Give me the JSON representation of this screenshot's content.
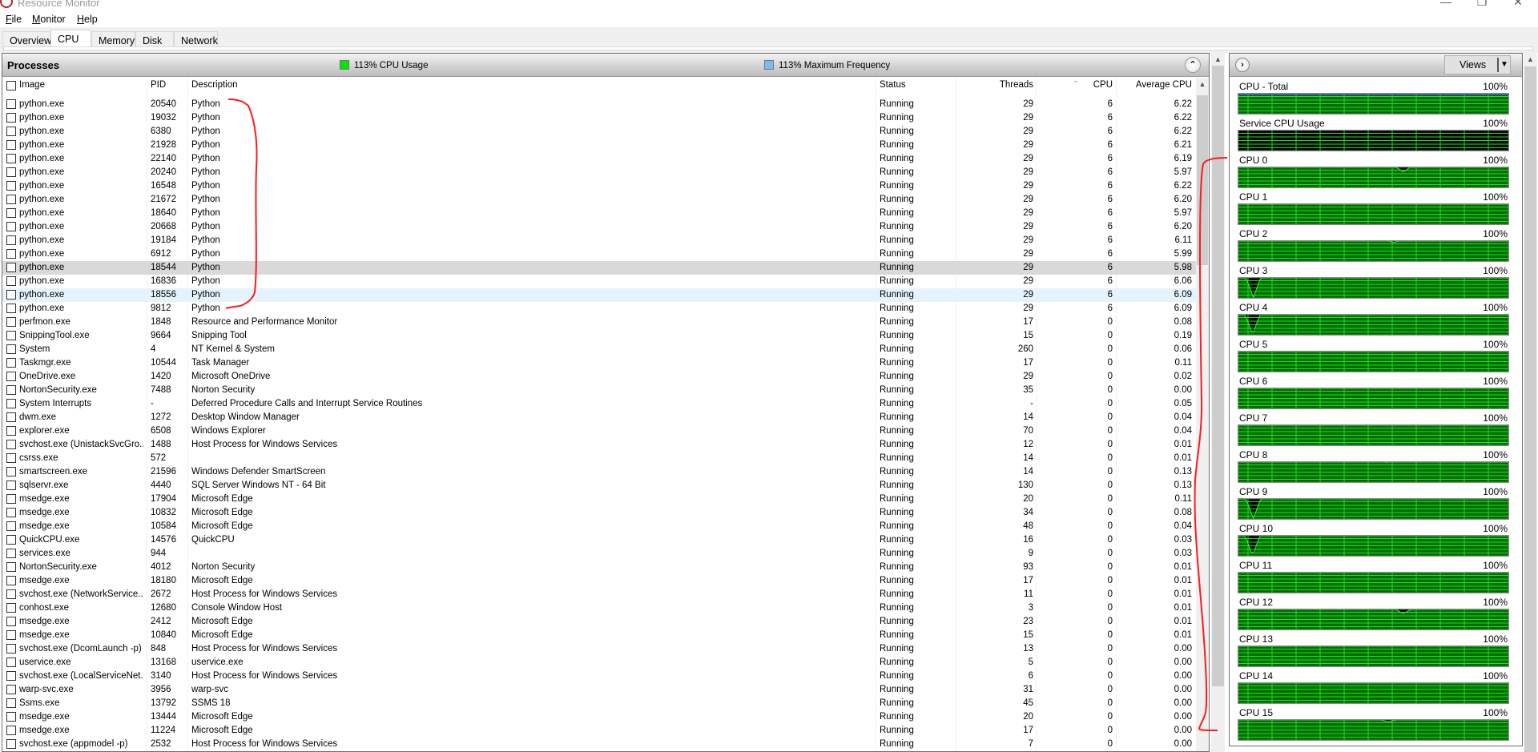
{
  "window": {
    "title": "Resource Monitor",
    "controls": {
      "minimize": "—",
      "maximize": "❐",
      "close": "✕"
    }
  },
  "menu": {
    "items": [
      {
        "label": "File",
        "accel": "F",
        "rest": "ile"
      },
      {
        "label": "Monitor",
        "accel": "M",
        "rest": "onitor"
      },
      {
        "label": "Help",
        "accel": "H",
        "rest": "elp"
      }
    ]
  },
  "tabs": [
    {
      "label": "Overview",
      "active": false
    },
    {
      "label": "CPU",
      "active": true
    },
    {
      "label": "Memory",
      "active": false
    },
    {
      "label": "Disk",
      "active": false
    },
    {
      "label": "Network",
      "active": false
    }
  ],
  "processes": {
    "title": "Processes",
    "cpu_usage": "113% CPU Usage",
    "cpu_usage_color": "#00e600",
    "max_frequency": "113% Maximum Frequency",
    "max_frequency_color": "#7fb8f5",
    "collapse_icon": "chevron-up-icon",
    "columns": {
      "image": "Image",
      "pid": "PID",
      "description": "Description",
      "status": "Status",
      "threads": "Threads",
      "cpu": "CPU",
      "average_cpu": "Average CPU"
    },
    "sorted_column": "cpu",
    "rows": [
      {
        "image": "python.exe",
        "pid": "20540",
        "description": "Python",
        "status": "Running",
        "threads": "29",
        "cpu": "6",
        "avg": "6.22"
      },
      {
        "image": "python.exe",
        "pid": "19032",
        "description": "Python",
        "status": "Running",
        "threads": "29",
        "cpu": "6",
        "avg": "6.22"
      },
      {
        "image": "python.exe",
        "pid": "6380",
        "description": "Python",
        "status": "Running",
        "threads": "29",
        "cpu": "6",
        "avg": "6.22"
      },
      {
        "image": "python.exe",
        "pid": "21928",
        "description": "Python",
        "status": "Running",
        "threads": "29",
        "cpu": "6",
        "avg": "6.21"
      },
      {
        "image": "python.exe",
        "pid": "22140",
        "description": "Python",
        "status": "Running",
        "threads": "29",
        "cpu": "6",
        "avg": "6.19"
      },
      {
        "image": "python.exe",
        "pid": "20240",
        "description": "Python",
        "status": "Running",
        "threads": "29",
        "cpu": "6",
        "avg": "5.97"
      },
      {
        "image": "python.exe",
        "pid": "16548",
        "description": "Python",
        "status": "Running",
        "threads": "29",
        "cpu": "6",
        "avg": "6.22"
      },
      {
        "image": "python.exe",
        "pid": "21672",
        "description": "Python",
        "status": "Running",
        "threads": "29",
        "cpu": "6",
        "avg": "6.20"
      },
      {
        "image": "python.exe",
        "pid": "18640",
        "description": "Python",
        "status": "Running",
        "threads": "29",
        "cpu": "6",
        "avg": "5.97"
      },
      {
        "image": "python.exe",
        "pid": "20668",
        "description": "Python",
        "status": "Running",
        "threads": "29",
        "cpu": "6",
        "avg": "6.20"
      },
      {
        "image": "python.exe",
        "pid": "19184",
        "description": "Python",
        "status": "Running",
        "threads": "29",
        "cpu": "6",
        "avg": "6.11"
      },
      {
        "image": "python.exe",
        "pid": "6912",
        "description": "Python",
        "status": "Running",
        "threads": "29",
        "cpu": "6",
        "avg": "5.99"
      },
      {
        "image": "python.exe",
        "pid": "18544",
        "description": "Python",
        "status": "Running",
        "threads": "29",
        "cpu": "6",
        "avg": "5.98",
        "state": "selected"
      },
      {
        "image": "python.exe",
        "pid": "16836",
        "description": "Python",
        "status": "Running",
        "threads": "29",
        "cpu": "6",
        "avg": "6.06"
      },
      {
        "image": "python.exe",
        "pid": "18556",
        "description": "Python",
        "status": "Running",
        "threads": "29",
        "cpu": "6",
        "avg": "6.09",
        "state": "hover"
      },
      {
        "image": "python.exe",
        "pid": "9812",
        "description": "Python",
        "status": "Running",
        "threads": "29",
        "cpu": "6",
        "avg": "6.09"
      },
      {
        "image": "perfmon.exe",
        "pid": "1848",
        "description": "Resource and Performance Monitor",
        "status": "Running",
        "threads": "17",
        "cpu": "0",
        "avg": "0.08"
      },
      {
        "image": "SnippingTool.exe",
        "pid": "9664",
        "description": "Snipping Tool",
        "status": "Running",
        "threads": "15",
        "cpu": "0",
        "avg": "0.19"
      },
      {
        "image": "System",
        "pid": "4",
        "description": "NT Kernel & System",
        "status": "Running",
        "threads": "260",
        "cpu": "0",
        "avg": "0.06"
      },
      {
        "image": "Taskmgr.exe",
        "pid": "10544",
        "description": "Task Manager",
        "status": "Running",
        "threads": "17",
        "cpu": "0",
        "avg": "0.11"
      },
      {
        "image": "OneDrive.exe",
        "pid": "1420",
        "description": "Microsoft OneDrive",
        "status": "Running",
        "threads": "29",
        "cpu": "0",
        "avg": "0.02"
      },
      {
        "image": "NortonSecurity.exe",
        "pid": "7488",
        "description": "Norton Security",
        "status": "Running",
        "threads": "35",
        "cpu": "0",
        "avg": "0.00"
      },
      {
        "image": "System Interrupts",
        "pid": "-",
        "description": "Deferred Procedure Calls and Interrupt Service Routines",
        "status": "Running",
        "threads": "-",
        "cpu": "0",
        "avg": "0.05"
      },
      {
        "image": "dwm.exe",
        "pid": "1272",
        "description": "Desktop Window Manager",
        "status": "Running",
        "threads": "14",
        "cpu": "0",
        "avg": "0.04"
      },
      {
        "image": "explorer.exe",
        "pid": "6508",
        "description": "Windows Explorer",
        "status": "Running",
        "threads": "70",
        "cpu": "0",
        "avg": "0.04"
      },
      {
        "image": "svchost.exe (UnistackSvcGro...",
        "pid": "1488",
        "description": "Host Process for Windows Services",
        "status": "Running",
        "threads": "12",
        "cpu": "0",
        "avg": "0.01"
      },
      {
        "image": "csrss.exe",
        "pid": "572",
        "description": "",
        "status": "Running",
        "threads": "14",
        "cpu": "0",
        "avg": "0.01"
      },
      {
        "image": "smartscreen.exe",
        "pid": "21596",
        "description": "Windows Defender SmartScreen",
        "status": "Running",
        "threads": "14",
        "cpu": "0",
        "avg": "0.13"
      },
      {
        "image": "sqlservr.exe",
        "pid": "4440",
        "description": "SQL Server Windows NT - 64 Bit",
        "status": "Running",
        "threads": "130",
        "cpu": "0",
        "avg": "0.13"
      },
      {
        "image": "msedge.exe",
        "pid": "17904",
        "description": "Microsoft Edge",
        "status": "Running",
        "threads": "20",
        "cpu": "0",
        "avg": "0.11"
      },
      {
        "image": "msedge.exe",
        "pid": "10832",
        "description": "Microsoft Edge",
        "status": "Running",
        "threads": "34",
        "cpu": "0",
        "avg": "0.08"
      },
      {
        "image": "msedge.exe",
        "pid": "10584",
        "description": "Microsoft Edge",
        "status": "Running",
        "threads": "48",
        "cpu": "0",
        "avg": "0.04"
      },
      {
        "image": "QuickCPU.exe",
        "pid": "14576",
        "description": "QuickCPU",
        "status": "Running",
        "threads": "16",
        "cpu": "0",
        "avg": "0.03"
      },
      {
        "image": "services.exe",
        "pid": "944",
        "description": "",
        "status": "Running",
        "threads": "9",
        "cpu": "0",
        "avg": "0.03"
      },
      {
        "image": "NortonSecurity.exe",
        "pid": "4012",
        "description": "Norton Security",
        "status": "Running",
        "threads": "93",
        "cpu": "0",
        "avg": "0.01"
      },
      {
        "image": "msedge.exe",
        "pid": "18180",
        "description": "Microsoft Edge",
        "status": "Running",
        "threads": "17",
        "cpu": "0",
        "avg": "0.01"
      },
      {
        "image": "svchost.exe (NetworkService...",
        "pid": "2672",
        "description": "Host Process for Windows Services",
        "status": "Running",
        "threads": "11",
        "cpu": "0",
        "avg": "0.01"
      },
      {
        "image": "conhost.exe",
        "pid": "12680",
        "description": "Console Window Host",
        "status": "Running",
        "threads": "3",
        "cpu": "0",
        "avg": "0.01"
      },
      {
        "image": "msedge.exe",
        "pid": "2412",
        "description": "Microsoft Edge",
        "status": "Running",
        "threads": "23",
        "cpu": "0",
        "avg": "0.01"
      },
      {
        "image": "msedge.exe",
        "pid": "10840",
        "description": "Microsoft Edge",
        "status": "Running",
        "threads": "15",
        "cpu": "0",
        "avg": "0.01"
      },
      {
        "image": "svchost.exe (DcomLaunch -p)",
        "pid": "848",
        "description": "Host Process for Windows Services",
        "status": "Running",
        "threads": "13",
        "cpu": "0",
        "avg": "0.00"
      },
      {
        "image": "uservice.exe",
        "pid": "13168",
        "description": "uservice.exe",
        "status": "Running",
        "threads": "5",
        "cpu": "0",
        "avg": "0.00"
      },
      {
        "image": "svchost.exe (LocalServiceNet...",
        "pid": "3140",
        "description": "Host Process for Windows Services",
        "status": "Running",
        "threads": "6",
        "cpu": "0",
        "avg": "0.00"
      },
      {
        "image": "warp-svc.exe",
        "pid": "3956",
        "description": "warp-svc",
        "status": "Running",
        "threads": "31",
        "cpu": "0",
        "avg": "0.00"
      },
      {
        "image": "Ssms.exe",
        "pid": "13792",
        "description": "SSMS 18",
        "status": "Running",
        "threads": "45",
        "cpu": "0",
        "avg": "0.00"
      },
      {
        "image": "msedge.exe",
        "pid": "13444",
        "description": "Microsoft Edge",
        "status": "Running",
        "threads": "20",
        "cpu": "0",
        "avg": "0.00"
      },
      {
        "image": "msedge.exe",
        "pid": "11224",
        "description": "Microsoft Edge",
        "status": "Running",
        "threads": "17",
        "cpu": "0",
        "avg": "0.00"
      },
      {
        "image": "svchost.exe (appmodel -p)",
        "pid": "2532",
        "description": "Host Process for Windows Services",
        "status": "Running",
        "threads": "7",
        "cpu": "0",
        "avg": "0.00"
      }
    ]
  },
  "right_panel": {
    "expand_icon": "chevron-right-icon",
    "views_label": "Views",
    "graphs": [
      {
        "label": "CPU - Total",
        "max": "100%",
        "kind": "total",
        "usage": 0.98,
        "dips": []
      },
      {
        "label": "Service CPU Usage",
        "max": "100%",
        "kind": "service",
        "usage": 0.03,
        "dips": []
      },
      {
        "label": "CPU 0",
        "max": "100%",
        "kind": "cpu",
        "usage": 1.0,
        "dips": [
          {
            "at": 0.61,
            "depth": 0.25
          }
        ]
      },
      {
        "label": "CPU 1",
        "max": "100%",
        "kind": "cpu",
        "usage": 1.0,
        "dips": []
      },
      {
        "label": "CPU 2",
        "max": "100%",
        "kind": "cpu",
        "usage": 1.0,
        "dips": [
          {
            "at": 0.575,
            "depth": 0.1
          }
        ]
      },
      {
        "label": "CPU 3",
        "max": "100%",
        "kind": "cpu",
        "usage": 1.0,
        "dips": [
          {
            "at": 0.058,
            "depth": 0.95
          }
        ]
      },
      {
        "label": "CPU 4",
        "max": "100%",
        "kind": "cpu",
        "usage": 1.0,
        "dips": [
          {
            "at": 0.055,
            "depth": 0.95
          }
        ]
      },
      {
        "label": "CPU 5",
        "max": "100%",
        "kind": "cpu",
        "usage": 1.0,
        "dips": []
      },
      {
        "label": "CPU 6",
        "max": "100%",
        "kind": "cpu",
        "usage": 1.0,
        "dips": []
      },
      {
        "label": "CPU 7",
        "max": "100%",
        "kind": "cpu",
        "usage": 1.0,
        "dips": []
      },
      {
        "label": "CPU 8",
        "max": "100%",
        "kind": "cpu",
        "usage": 1.0,
        "dips": [
          {
            "at": 0.55,
            "depth": 0.05
          }
        ]
      },
      {
        "label": "CPU 9",
        "max": "100%",
        "kind": "cpu",
        "usage": 1.0,
        "dips": [
          {
            "at": 0.058,
            "depth": 0.95
          }
        ]
      },
      {
        "label": "CPU 10",
        "max": "100%",
        "kind": "cpu",
        "usage": 1.0,
        "dips": [
          {
            "at": 0.055,
            "depth": 0.95
          }
        ]
      },
      {
        "label": "CPU 11",
        "max": "100%",
        "kind": "cpu",
        "usage": 1.0,
        "dips": []
      },
      {
        "label": "CPU 12",
        "max": "100%",
        "kind": "cpu",
        "usage": 0.97,
        "dips": [
          {
            "at": 0.61,
            "depth": 0.2
          }
        ]
      },
      {
        "label": "CPU 13",
        "max": "100%",
        "kind": "cpu",
        "usage": 0.97,
        "dips": []
      },
      {
        "label": "CPU 14",
        "max": "100%",
        "kind": "cpu",
        "usage": 0.97,
        "dips": []
      },
      {
        "label": "CPU 15",
        "max": "100%",
        "kind": "cpu",
        "usage": 0.97,
        "dips": [
          {
            "at": 0.555,
            "depth": 0.1
          }
        ]
      }
    ]
  }
}
